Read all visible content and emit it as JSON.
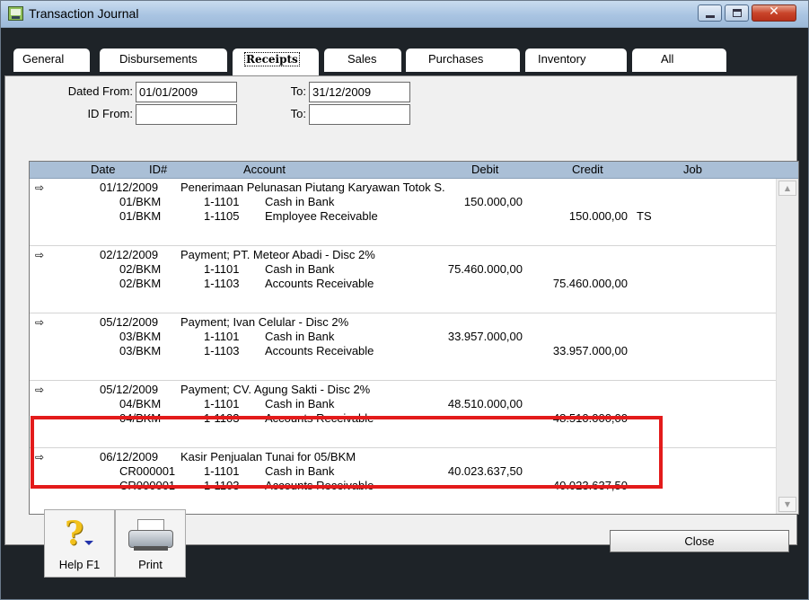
{
  "window": {
    "title": "Transaction Journal"
  },
  "tabs": [
    "General",
    "Disbursements",
    "Receipts",
    "Sales",
    "Purchases",
    "Inventory",
    "All"
  ],
  "filters": {
    "dated_from_label": "Dated From:",
    "dated_from": "01/01/2009",
    "dated_to_label": "To:",
    "dated_to": "31/12/2009",
    "id_from_label": "ID From:",
    "id_from": "",
    "id_to_label": "To:",
    "id_to": ""
  },
  "grid": {
    "headers": {
      "date": "Date",
      "id": "ID#",
      "account": "Account",
      "debit": "Debit",
      "credit": "Credit",
      "job": "Job"
    },
    "entries": [
      {
        "date": "01/12/2009",
        "memo": "Penerimaan Pelunasan Piutang Karyawan Totok S.",
        "lines": [
          {
            "id": "01/BKM",
            "acct_no": "1-1101",
            "acct_name": "Cash in Bank",
            "debit": "150.000,00",
            "credit": "",
            "job": ""
          },
          {
            "id": "01/BKM",
            "acct_no": "1-1105",
            "acct_name": "Employee Receivable",
            "debit": "",
            "credit": "150.000,00",
            "job": "TS"
          }
        ]
      },
      {
        "date": "02/12/2009",
        "memo": "Payment; PT. Meteor Abadi - Disc 2%",
        "lines": [
          {
            "id": "02/BKM",
            "acct_no": "1-1101",
            "acct_name": "Cash in Bank",
            "debit": "75.460.000,00",
            "credit": "",
            "job": ""
          },
          {
            "id": "02/BKM",
            "acct_no": "1-1103",
            "acct_name": "Accounts Receivable",
            "debit": "",
            "credit": "75.460.000,00",
            "job": ""
          }
        ]
      },
      {
        "date": "05/12/2009",
        "memo": "Payment; Ivan Celular - Disc 2%",
        "lines": [
          {
            "id": "03/BKM",
            "acct_no": "1-1101",
            "acct_name": "Cash in Bank",
            "debit": "33.957.000,00",
            "credit": "",
            "job": ""
          },
          {
            "id": "03/BKM",
            "acct_no": "1-1103",
            "acct_name": "Accounts Receivable",
            "debit": "",
            "credit": "33.957.000,00",
            "job": ""
          }
        ]
      },
      {
        "date": "05/12/2009",
        "memo": "Payment; CV. Agung Sakti - Disc 2%",
        "lines": [
          {
            "id": "04/BKM",
            "acct_no": "1-1101",
            "acct_name": "Cash in Bank",
            "debit": "48.510.000,00",
            "credit": "",
            "job": ""
          },
          {
            "id": "04/BKM",
            "acct_no": "1-1103",
            "acct_name": "Accounts Receivable",
            "debit": "",
            "credit": "48.510.000,00",
            "job": ""
          }
        ]
      },
      {
        "date": "06/12/2009",
        "memo": "Kasir Penjualan Tunai for 05/BKM",
        "lines": [
          {
            "id": "CR000001",
            "acct_no": "1-1101",
            "acct_name": "Cash in Bank",
            "debit": "40.023.637,50",
            "credit": "",
            "job": ""
          },
          {
            "id": "CR000001",
            "acct_no": "1-1103",
            "acct_name": "Accounts Receivable",
            "debit": "",
            "credit": "40.023.637,50",
            "job": ""
          }
        ]
      }
    ]
  },
  "buttons": {
    "help": "Help F1",
    "print": "Print",
    "close": "Close"
  },
  "icons": {
    "row_arrow": "⇨",
    "scroll_up": "▲",
    "scroll_down": "▼"
  }
}
